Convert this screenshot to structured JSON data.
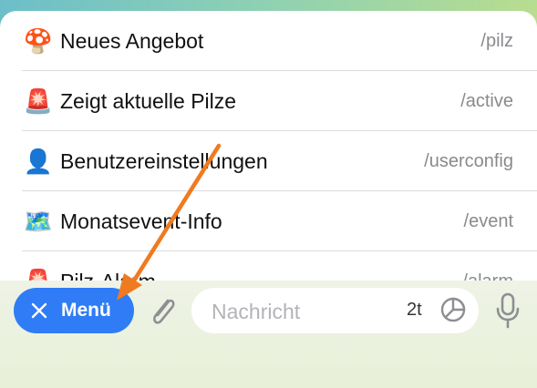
{
  "commands": [
    {
      "emoji": "🍄",
      "label": "Neues Angebot",
      "command": "/pilz"
    },
    {
      "emoji": "🚨",
      "label": "Zeigt aktuelle Pilze",
      "command": "/active"
    },
    {
      "emoji": "👤",
      "label": "Benutzereinstellungen",
      "command": "/userconfig"
    },
    {
      "emoji": "🗺️",
      "label": "Monatsevent-Info",
      "command": "/event"
    },
    {
      "emoji": "🚨",
      "label": "Pilz-Alarm",
      "command": "/alarm"
    }
  ],
  "menu_button": {
    "label": "Menü",
    "icon": "close-icon",
    "color": "#2f7cf6"
  },
  "message_input": {
    "placeholder": "Nachricht",
    "counter": "2t"
  },
  "icons": {
    "attach": "paperclip-icon",
    "timer": "timer-icon",
    "mic": "microphone-icon"
  },
  "annotation": {
    "color": "#f07a1f"
  }
}
